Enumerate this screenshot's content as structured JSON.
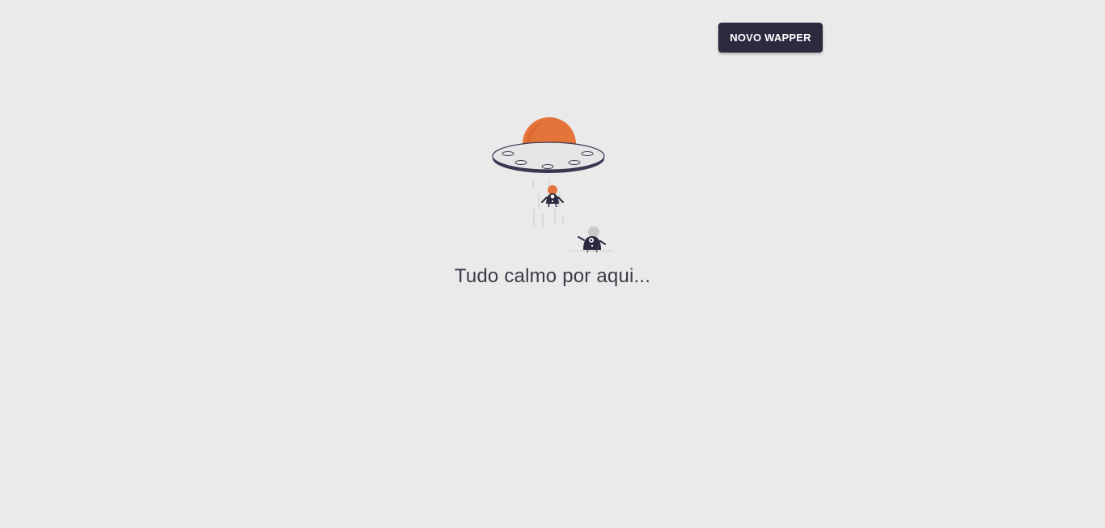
{
  "header": {
    "new_button_label": "NOVO WAPPER"
  },
  "empty_state": {
    "illustration_icon": "ufo-abduction-illustration",
    "message": "Tudo calmo por aqui..."
  },
  "colors": {
    "background": "#eaeaea",
    "button_bg": "#2c2a3f",
    "button_text": "#ffffff",
    "accent_orange": "#e4743a",
    "text": "#3a3a48"
  }
}
